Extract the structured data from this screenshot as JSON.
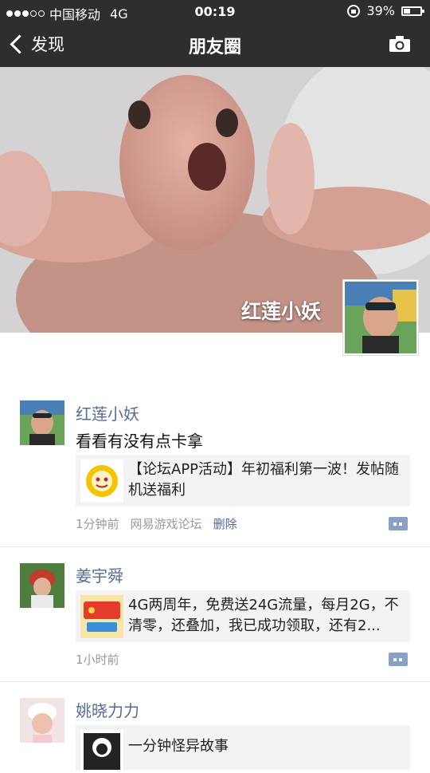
{
  "status_bar": {
    "carrier": "中国移动",
    "network": "4G",
    "time": "00:19",
    "battery": "39%"
  },
  "nav": {
    "back_label": "发现",
    "title": "朋友圈"
  },
  "cover": {
    "owner_name": "红莲小妖"
  },
  "posts": [
    {
      "username": "红莲小妖",
      "text": "看看有没有点卡拿",
      "share_text": "【论坛APP活动】年初福利第一波！发帖随机送福利",
      "time": "1分钟前",
      "source": "网易游戏论坛",
      "delete_label": "删除"
    },
    {
      "username": "姜宇舜",
      "share_text": "4G两周年，免费送24G流量，每月2G，不清零，还叠加，我已成功领取，还有2...",
      "time": "1小时前"
    },
    {
      "username": "姚晓力力",
      "share_text": "一分钟怪异故事"
    }
  ],
  "colors": {
    "link": "#576b95",
    "nav_bg": "#2e2e2e",
    "share_bg": "#f3f3f5"
  }
}
